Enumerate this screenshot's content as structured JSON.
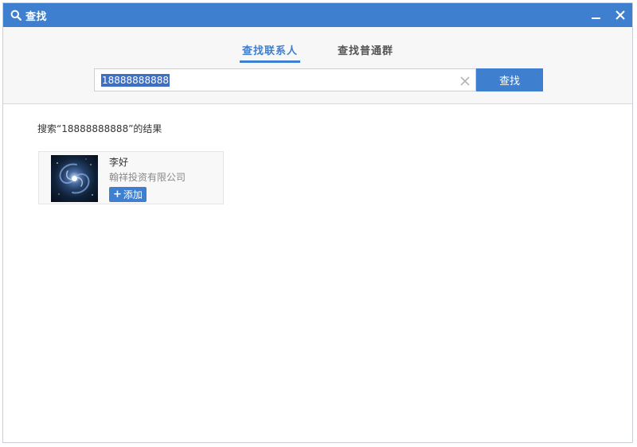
{
  "window": {
    "title": "查找"
  },
  "tabs": [
    {
      "label": "查找联系人",
      "active": true
    },
    {
      "label": "查找普通群",
      "active": false
    }
  ],
  "search": {
    "value": "18888888888",
    "button_label": "查找"
  },
  "results": {
    "heading": "搜索“18888888888”的结果",
    "items": [
      {
        "name": "李好",
        "company": "翰祥投资有限公司",
        "add_label": "添加",
        "add_icon": "plus-icon",
        "avatar": "galaxy-avatar"
      }
    ]
  },
  "colors": {
    "accent": "#3f7fcf",
    "selection": "#3d6fc4"
  }
}
